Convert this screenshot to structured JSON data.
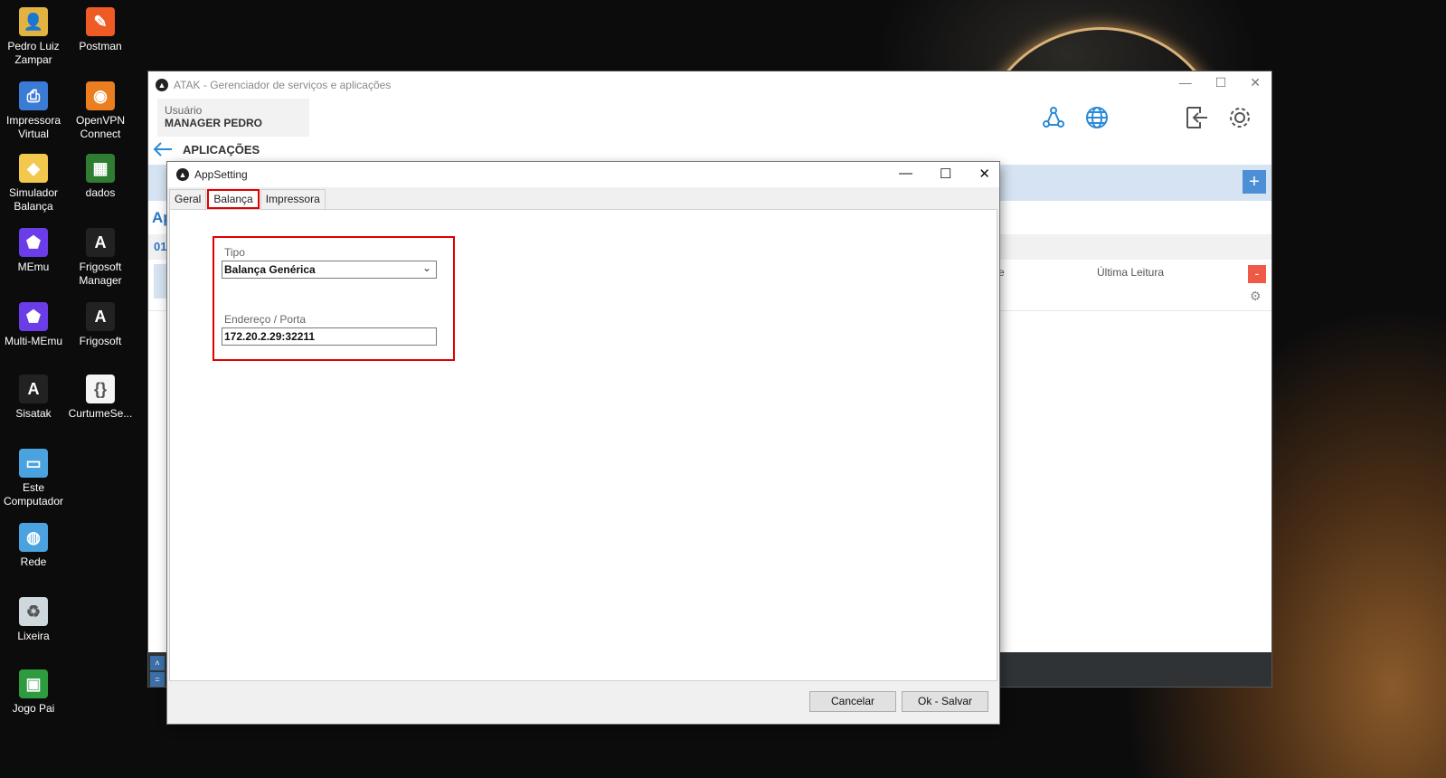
{
  "desktop": {
    "icons": [
      {
        "label": "Pedro Luiz Zampar",
        "icon": "user-folder-icon",
        "color": "#e3b341"
      },
      {
        "label": "Postman",
        "icon": "postman-icon",
        "color": "#ef5b25"
      },
      {
        "label": "Impressora Virtual",
        "icon": "printer-icon",
        "color": "#3a7bd5"
      },
      {
        "label": "OpenVPN Connect",
        "icon": "openvpn-icon",
        "color": "#ea7e20"
      },
      {
        "label": "Simulador Balança",
        "icon": "python-icon",
        "color": "#f2c94c"
      },
      {
        "label": "dados",
        "icon": "spreadsheet-icon",
        "color": "#2e7d32"
      },
      {
        "label": "MEmu",
        "icon": "memu-icon",
        "color": "#6a3de8"
      },
      {
        "label": "Frigosoft Manager",
        "icon": "frigosoft-manager-icon",
        "color": "#222222"
      },
      {
        "label": "Multi-MEmu",
        "icon": "multi-memu-icon",
        "color": "#6a3de8"
      },
      {
        "label": "Frigosoft",
        "icon": "frigosoft-icon",
        "color": "#222222"
      },
      {
        "label": "Sisatak",
        "icon": "sisatak-icon",
        "color": "#222222"
      },
      {
        "label": "CurtumeSe...",
        "icon": "json-file-icon",
        "color": "#f5f5f5"
      },
      {
        "label": "Este Computador",
        "icon": "computer-icon",
        "color": "#4aa3df"
      },
      {
        "label": "Rede",
        "icon": "network-icon",
        "color": "#4aa3df"
      },
      {
        "label": "Lixeira",
        "icon": "recycle-bin-icon",
        "color": "#cfd8dc"
      },
      {
        "label": "Jogo Pai",
        "icon": "game-icon",
        "color": "#2e9b3e"
      }
    ]
  },
  "main_window": {
    "title": "ATAK - Gerenciador de serviços e aplicações",
    "user_label": "Usuário",
    "user_name": "MANAGER PEDRO",
    "section_title": "APLICAÇÕES",
    "plus_label": "+",
    "app_label": "Ap",
    "row_id": "01",
    "col_fragment": "e",
    "col_last_read": "Última Leitura",
    "minus_label": "-"
  },
  "dialog": {
    "title": "AppSetting",
    "tabs": [
      "Geral",
      "Balança",
      "Impressora"
    ],
    "active_tab": "Balança",
    "tipo_label": "Tipo",
    "tipo_value": "Balança Genérica",
    "endereco_label": "Endereço / Porta",
    "endereco_value": "172.20.2.29:32211",
    "cancel_label": "Cancelar",
    "ok_label": "Ok - Salvar"
  },
  "colors": {
    "accent_blue": "#2a78c6",
    "highlight_red": "#e00000",
    "minus_red": "#ef5a48"
  }
}
